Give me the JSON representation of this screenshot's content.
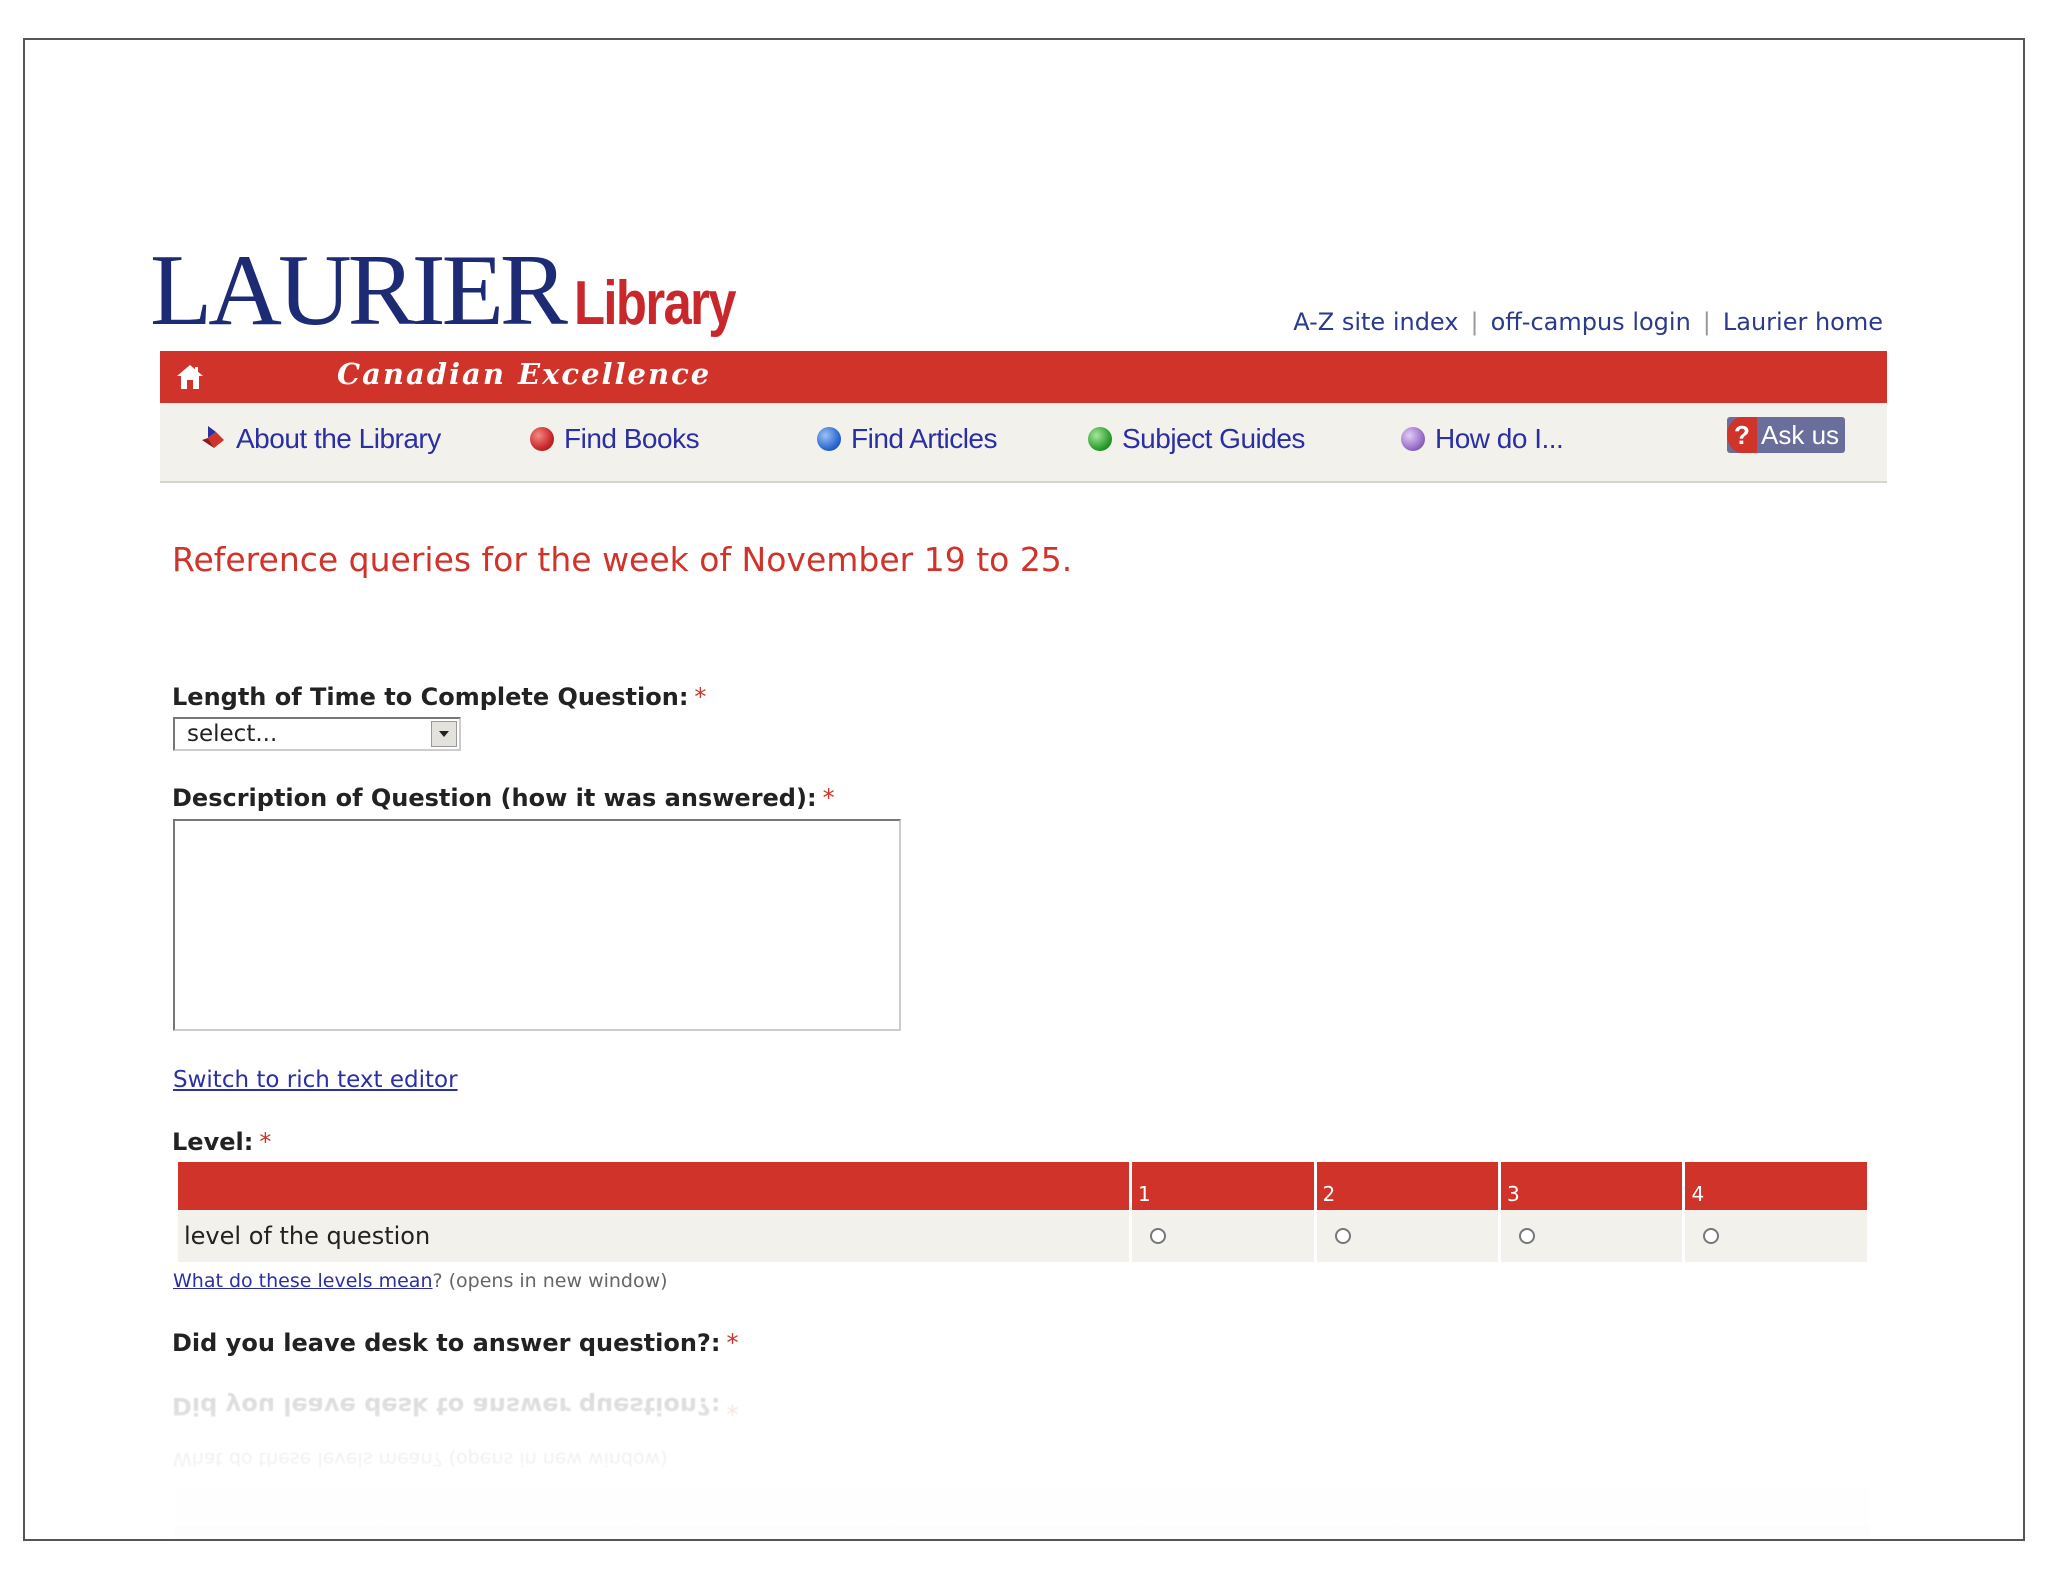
{
  "header": {
    "logo_word": "LAURIER",
    "logo_library": "Library",
    "tagline": "Canadian Excellence",
    "top_links": [
      "A-Z site index",
      "off-campus login",
      "Laurier home"
    ]
  },
  "nav": {
    "items": [
      {
        "label": "About the Library"
      },
      {
        "label": "Find Books",
        "color": "#d0332a"
      },
      {
        "label": "Find Articles",
        "color": "#2f6bd0"
      },
      {
        "label": "Subject Guides",
        "color": "#2fa02f"
      },
      {
        "label": "How do I...",
        "color": "#9a6fc8"
      }
    ],
    "ask": {
      "q": "?",
      "label": "Ask us"
    }
  },
  "form": {
    "heading": "Reference queries for the week of November 19 to 25.",
    "time_label": "Length of Time to Complete Question:",
    "time_select_value": "select...",
    "desc_label": "Description of Question (how it was answered):",
    "rich_text_link": "Switch to rich text editor",
    "level_label": "Level:",
    "level_columns": [
      "1",
      "2",
      "3",
      "4"
    ],
    "level_row_label": "level of the question",
    "levels_link": "What do these levels mean",
    "levels_note": "? (opens in new window)",
    "desk_label": "Did you leave desk to answer question?:",
    "required_mark": "*"
  }
}
